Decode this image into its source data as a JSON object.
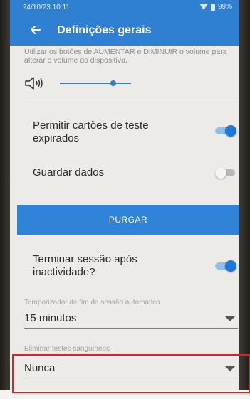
{
  "status_bar": {
    "time": "24/10/23 10:11",
    "battery": "99%"
  },
  "header": {
    "title": "Definições gerais"
  },
  "volume": {
    "description": "Utilizar os botões de AUMENTAR e DIMINUIR o volume para alterar o volume do dispositivo.",
    "level_fraction": 0.75
  },
  "settings": {
    "expired_cards_label": "Permitir cartões de teste expirados",
    "expired_cards_on": true,
    "save_data_label": "Guardar dados",
    "save_data_on": false,
    "purge_label": "PURGAR",
    "logout_inactivity_label": "Terminar sessão após inactividade?",
    "logout_inactivity_on": true
  },
  "session_timer": {
    "caption": "Temporizador de fim de sessão automático",
    "value": "15 minutos"
  },
  "delete_blood_tests": {
    "caption": "Eliminar testes sanguíneos",
    "value": "Nunca"
  },
  "colors": {
    "accent": "#2f7fd3",
    "highlight": "#e41e1e"
  },
  "icons": [
    "back-arrow-icon",
    "wifi-icon",
    "battery-icon",
    "speaker-icon",
    "dropdown-arrow-icon"
  ]
}
